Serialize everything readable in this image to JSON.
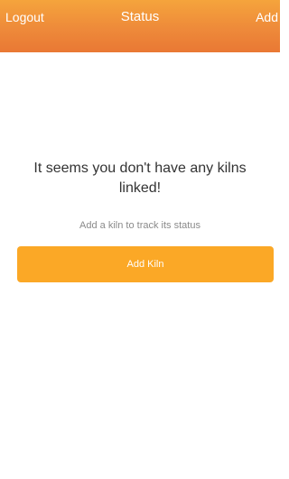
{
  "navbar": {
    "left_label": "Logout",
    "title": "Status",
    "right_label": "Add"
  },
  "empty_state": {
    "title": "It seems you don't have any kilns linked!",
    "subtitle": "Add a kiln to track its status",
    "button_label": "Add Kiln"
  },
  "colors": {
    "navbar_top": "#f5a43c",
    "navbar_bottom": "#e97834",
    "button": "#fba826"
  }
}
